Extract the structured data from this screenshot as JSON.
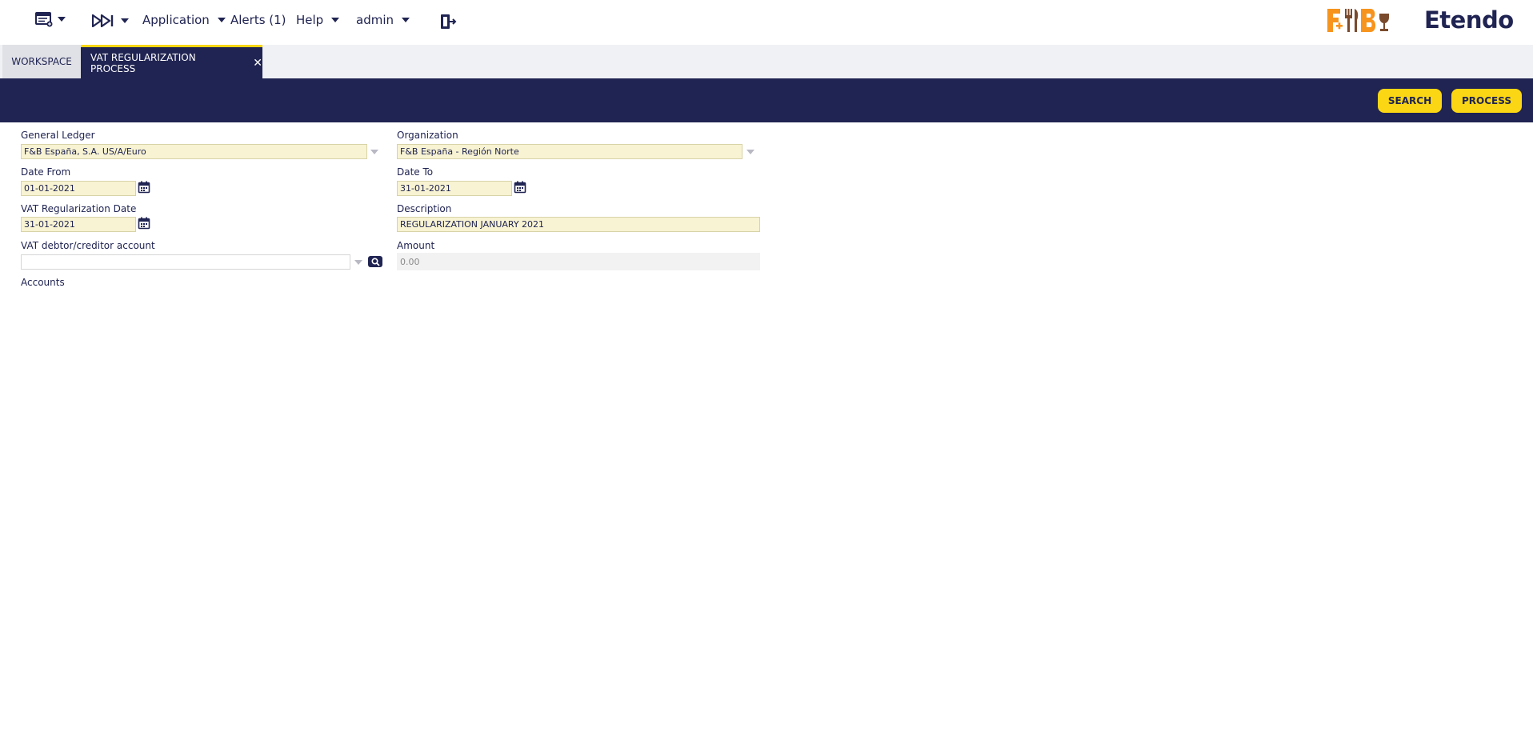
{
  "nav": {
    "application": "Application",
    "alerts": "Alerts (1)",
    "help": "Help",
    "user": "admin"
  },
  "brand": {
    "logo_left": "F&B",
    "logo_right": "Etendo",
    "colors": {
      "navy": "#202452",
      "yellow": "#fad614",
      "orange": "#f7941d",
      "brown": "#7a4a2c"
    }
  },
  "tabs": {
    "workspace": "WORKSPACE",
    "active": "VAT REGULARIZATION PROCESS"
  },
  "toolbar": {
    "search": "SEARCH",
    "process": "PROCESS"
  },
  "form": {
    "general_ledger": {
      "label": "General Ledger",
      "value": "F&B España, S.A. US/A/Euro"
    },
    "organization": {
      "label": "Organization",
      "value": "F&B España - Región Norte"
    },
    "date_from": {
      "label": "Date From",
      "value": "01-01-2021"
    },
    "date_to": {
      "label": "Date To",
      "value": "31-01-2021"
    },
    "vat_reg_date": {
      "label": "VAT Regularization Date",
      "value": "31-01-2021"
    },
    "description": {
      "label": "Description",
      "value": "REGULARIZATION JANUARY 2021"
    },
    "vat_account": {
      "label": "VAT debtor/creditor account",
      "value": ""
    },
    "amount": {
      "label": "Amount",
      "value": "0.00"
    },
    "accounts": {
      "label": "Accounts"
    }
  }
}
